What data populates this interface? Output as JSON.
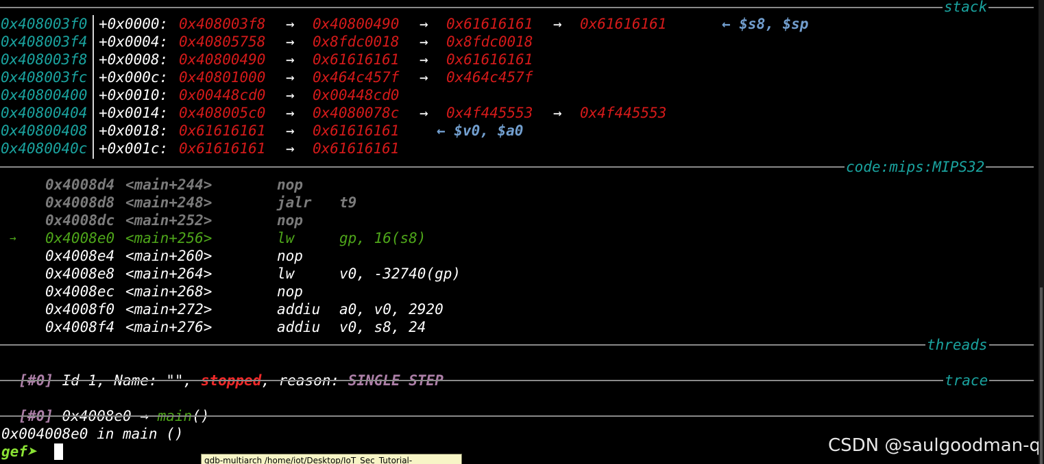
{
  "sections": {
    "stack": "stack",
    "code": "code:mips:MIPS32",
    "threads": "threads",
    "trace": "trace"
  },
  "stack_rows": [
    {
      "addr": "0x408003f0",
      "offset": "+0x0000:",
      "chain": [
        "0x408003f8",
        "0x40800490",
        "0x61616161",
        "0x61616161"
      ],
      "note": "← $s8, $sp"
    },
    {
      "addr": "0x408003f4",
      "offset": "+0x0004:",
      "chain": [
        "0x40805758",
        "0x8fdc0018",
        "0x8fdc0018"
      ],
      "note": ""
    },
    {
      "addr": "0x408003f8",
      "offset": "+0x0008:",
      "chain": [
        "0x40800490",
        "0x61616161",
        "0x61616161"
      ],
      "note": ""
    },
    {
      "addr": "0x408003fc",
      "offset": "+0x000c:",
      "chain": [
        "0x40801000",
        "0x464c457f",
        "0x464c457f"
      ],
      "note": ""
    },
    {
      "addr": "0x40800400",
      "offset": "+0x0010:",
      "chain": [
        "0x00448cd0",
        "0x00448cd0"
      ],
      "note": ""
    },
    {
      "addr": "0x40800404",
      "offset": "+0x0014:",
      "chain": [
        "0x408005c0",
        "0x4080078c",
        "0x4f445553",
        "0x4f445553"
      ],
      "note": ""
    },
    {
      "addr": "0x40800408",
      "offset": "+0x0018:",
      "chain": [
        "0x61616161",
        "0x61616161"
      ],
      "note": "← $v0, $a0"
    },
    {
      "addr": "0x4080040c",
      "offset": "+0x001c:",
      "chain": [
        "0x61616161",
        "0x61616161"
      ],
      "note": ""
    }
  ],
  "arrow": "→",
  "code_rows": [
    {
      "marker": "",
      "addr": "0x4008d4",
      "sym": "<main+244>",
      "op": "nop",
      "args": "",
      "state": "past"
    },
    {
      "marker": "",
      "addr": "0x4008d8",
      "sym": "<main+248>",
      "op": "jalr",
      "args": "t9",
      "state": "past"
    },
    {
      "marker": "",
      "addr": "0x4008dc",
      "sym": "<main+252>",
      "op": "nop",
      "args": "",
      "state": "past"
    },
    {
      "marker": "→",
      "addr": "0x4008e0",
      "sym": "<main+256>",
      "op": "lw",
      "args": "gp, 16(s8)",
      "state": "current"
    },
    {
      "marker": "",
      "addr": "0x4008e4",
      "sym": "<main+260>",
      "op": "nop",
      "args": "",
      "state": "future"
    },
    {
      "marker": "",
      "addr": "0x4008e8",
      "sym": "<main+264>",
      "op": "lw",
      "args": "v0, -32740(gp)",
      "state": "future"
    },
    {
      "marker": "",
      "addr": "0x4008ec",
      "sym": "<main+268>",
      "op": "nop",
      "args": "",
      "state": "future"
    },
    {
      "marker": "",
      "addr": "0x4008f0",
      "sym": "<main+272>",
      "op": "addiu",
      "args": "a0, v0, 2920",
      "state": "future"
    },
    {
      "marker": "",
      "addr": "0x4008f4",
      "sym": "<main+276>",
      "op": "addiu",
      "args": "v0, s8, 24",
      "state": "future"
    }
  ],
  "thread": {
    "id_tag": "[#0]",
    "text_a": " Id 1, Name: \"\", ",
    "status": "stopped",
    "text_b": ", reason: ",
    "reason": "SINGLE STEP"
  },
  "trace": {
    "id_tag": "[#0]",
    "addr": " 0x4008e0 → ",
    "func": "main",
    "parens": "()"
  },
  "status_line": "0x004008e0 in main ()",
  "prompt": "gef➤ ",
  "tooltip": "gdb-multiarch /home/iot/Desktop/IoT_Sec_Tutorial-",
  "watermark": "CSDN @saulgoodman-q",
  "colors": {
    "address": "#1aa39f",
    "pointer": "#d51a1a",
    "register_note": "#729fcf",
    "current_line": "#4ea61a",
    "past_line": "#7b7b7b",
    "prompt": "#8ae234",
    "stopped": "#ef2929",
    "reason": "#ad7fa8"
  }
}
